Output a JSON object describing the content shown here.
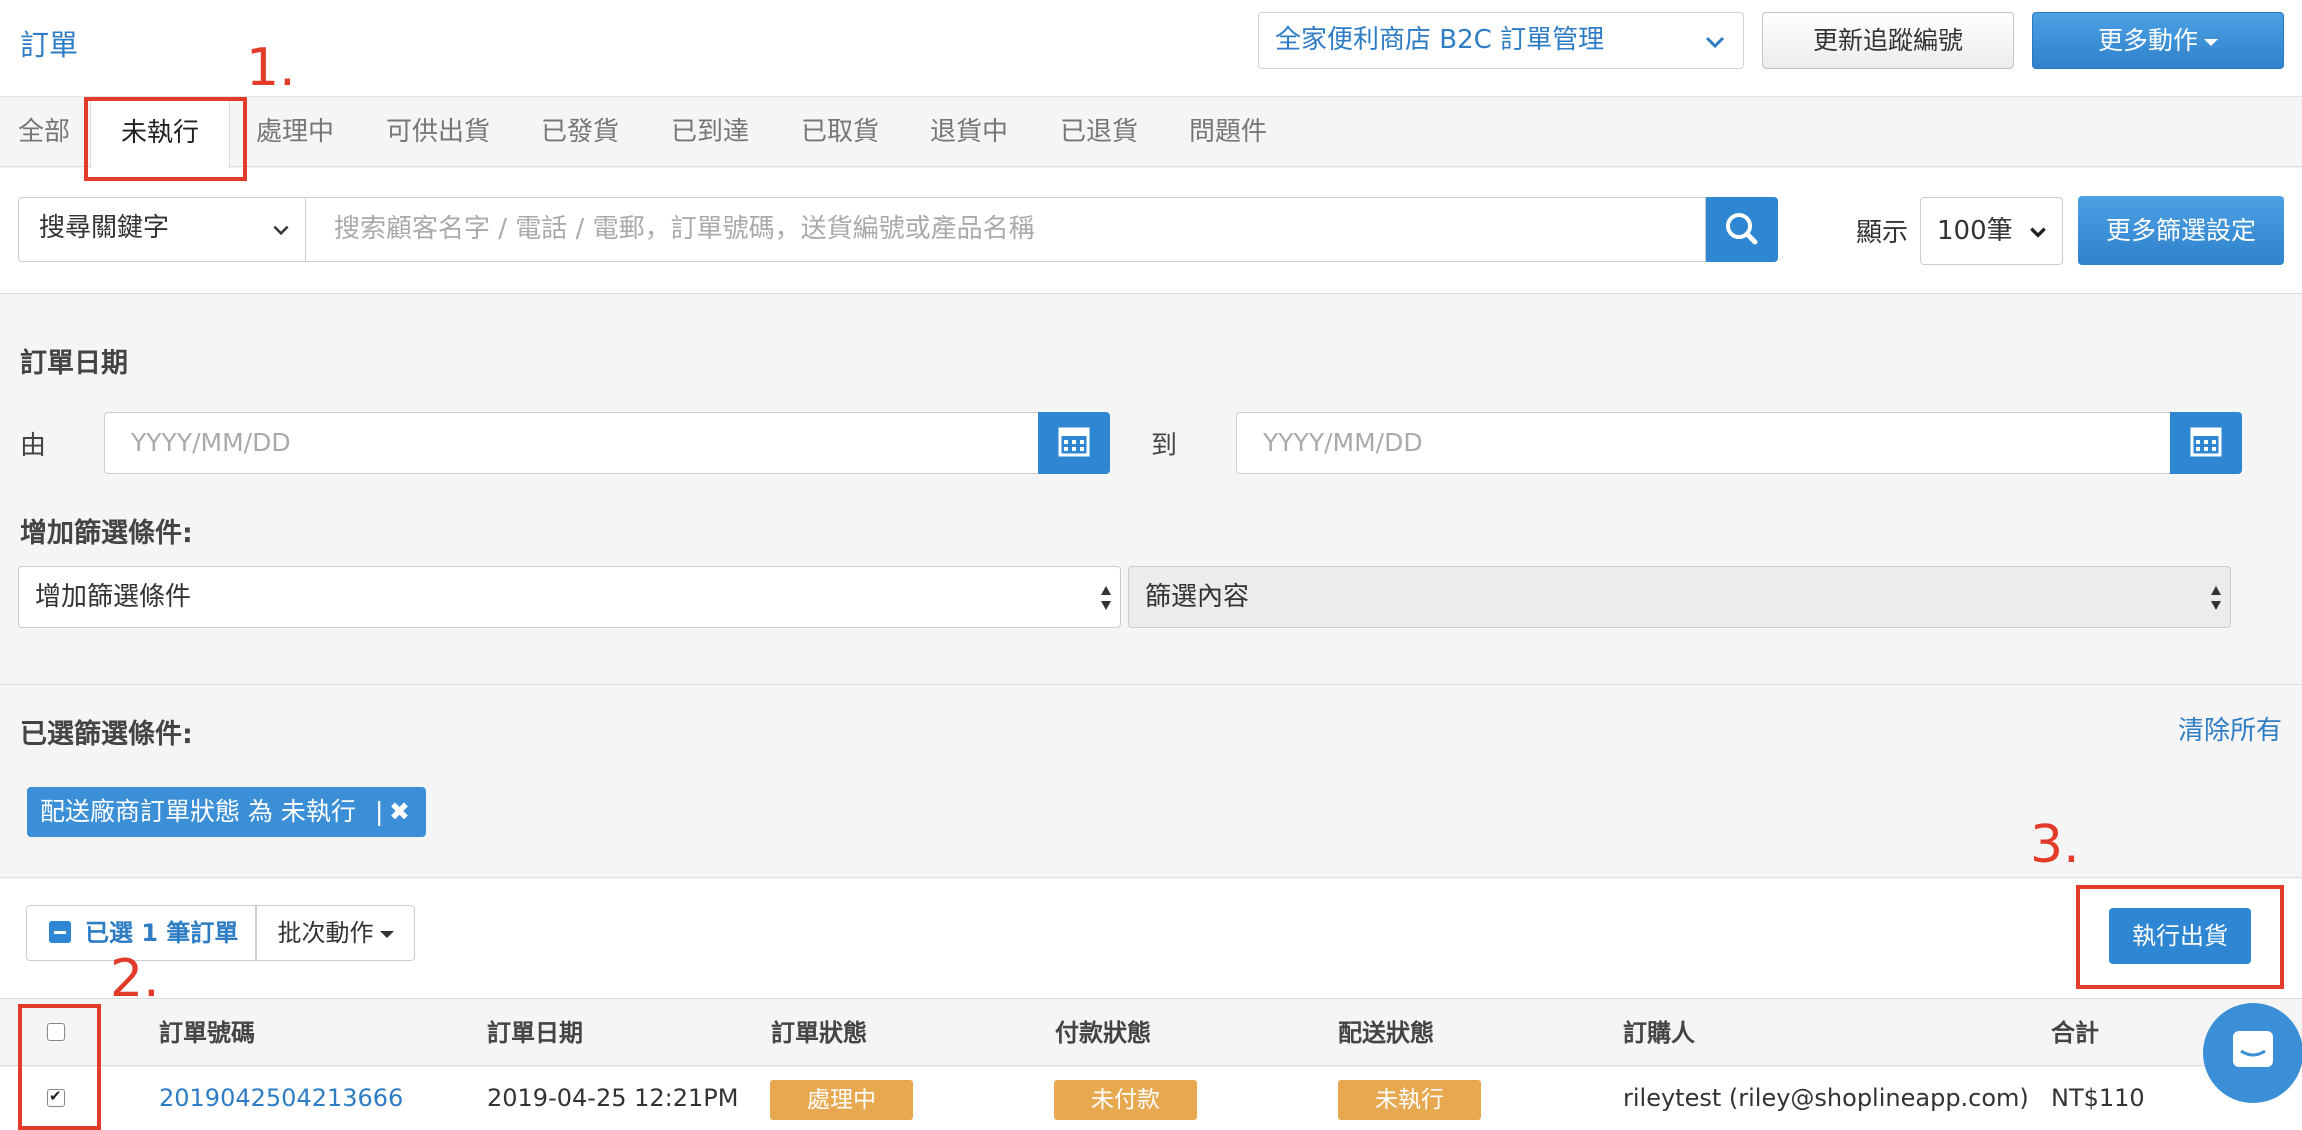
{
  "header": {
    "title": "訂單",
    "logistics_select": "全家便利商店 B2C 訂單管理",
    "update_tracking_label": "更新追蹤編號",
    "more_actions_label": "更多動作"
  },
  "tabs": [
    "全部",
    "未執行",
    "處理中",
    "可供出貨",
    "已發貨",
    "已到達",
    "已取貨",
    "退貨中",
    "已退貨",
    "問題件"
  ],
  "search": {
    "keyword_select": "搜尋關鍵字",
    "placeholder": "搜索顧客名字 / 電話 / 電郵，訂單號碼，送貨編號或產品名稱",
    "show_label": "顯示",
    "per_page": "100筆",
    "more_filter_label": "更多篩選設定"
  },
  "filters": {
    "date_title": "訂單日期",
    "from_label": "由",
    "to_label": "到",
    "date_placeholder": "YYYY/MM/DD",
    "add_condition_title": "增加篩選條件:",
    "add_condition_select": "增加篩選條件",
    "filter_content_select": "篩選內容"
  },
  "selected": {
    "title": "已選篩選條件:",
    "clear_all": "清除所有",
    "chip_text": "配送廠商訂單狀態 為 未執行",
    "chip_sep": "|"
  },
  "actions": {
    "selected_count": "已選 1 筆訂單",
    "batch_label": "批次動作",
    "ship_label": "執行出貨"
  },
  "table": {
    "headers": [
      "訂單號碼",
      "訂單日期",
      "訂單狀態",
      "付款狀態",
      "配送狀態",
      "訂購人",
      "合計"
    ],
    "rows": [
      {
        "order_no": "2019042504213666",
        "date": "2019-04-25 12:21PM",
        "order_status": "處理中",
        "payment_status": "未付款",
        "delivery_status": "未執行",
        "customer": "rileytest (riley@shoplineapp.com)",
        "total": "NT$110",
        "checked": true
      }
    ]
  },
  "annotations": [
    "1.",
    "2.",
    "3."
  ],
  "colors": {
    "link": "#2e7dc4",
    "primary": "#2f86d3",
    "badge": "#e7a850",
    "annotation": "#e23b2a"
  }
}
